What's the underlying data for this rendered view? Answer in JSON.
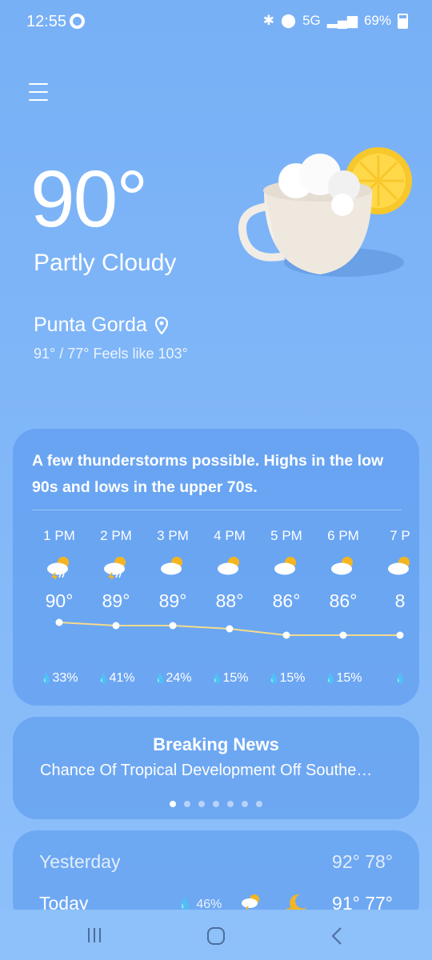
{
  "status": {
    "time": "12:55",
    "network": "5G",
    "battery": "69%"
  },
  "current": {
    "temperature": "90°",
    "condition": "Partly Cloudy",
    "location": "Punta Gorda",
    "hi_lo_feels": "91° / 77° Feels like 103°"
  },
  "hourly": {
    "summary": "A few thunderstorms possible. Highs in the low 90s and lows in the upper 70s.",
    "hours": [
      {
        "time": "1 PM",
        "icon": "thunderstorm-icon",
        "temp": "90°",
        "temp_value": 90,
        "precip": "33%"
      },
      {
        "time": "2 PM",
        "icon": "thunderstorm-icon",
        "temp": "89°",
        "temp_value": 89,
        "precip": "41%"
      },
      {
        "time": "3 PM",
        "icon": "partly-cloudy-icon",
        "temp": "89°",
        "temp_value": 89,
        "precip": "24%"
      },
      {
        "time": "4 PM",
        "icon": "partly-cloudy-icon",
        "temp": "88°",
        "temp_value": 88,
        "precip": "15%"
      },
      {
        "time": "5 PM",
        "icon": "partly-cloudy-icon",
        "temp": "86°",
        "temp_value": 86,
        "precip": "15%"
      },
      {
        "time": "6 PM",
        "icon": "partly-cloudy-icon",
        "temp": "86°",
        "temp_value": 86,
        "precip": "15%"
      },
      {
        "time": "7 P",
        "icon": "partly-cloudy-icon",
        "temp": "8",
        "temp_value": 86,
        "precip": ""
      }
    ]
  },
  "news": {
    "title": "Breaking News",
    "headline": "Chance Of Tropical Development Off Southe…",
    "page_count": 7,
    "active_page": 0
  },
  "daily": [
    {
      "day": "Yesterday",
      "temps": "92° 78°"
    },
    {
      "day": "Today",
      "precip": "46%",
      "temps": "91° 77°"
    }
  ],
  "colors": {
    "sun": "#f5b521",
    "curve": "#f4dc8a"
  }
}
